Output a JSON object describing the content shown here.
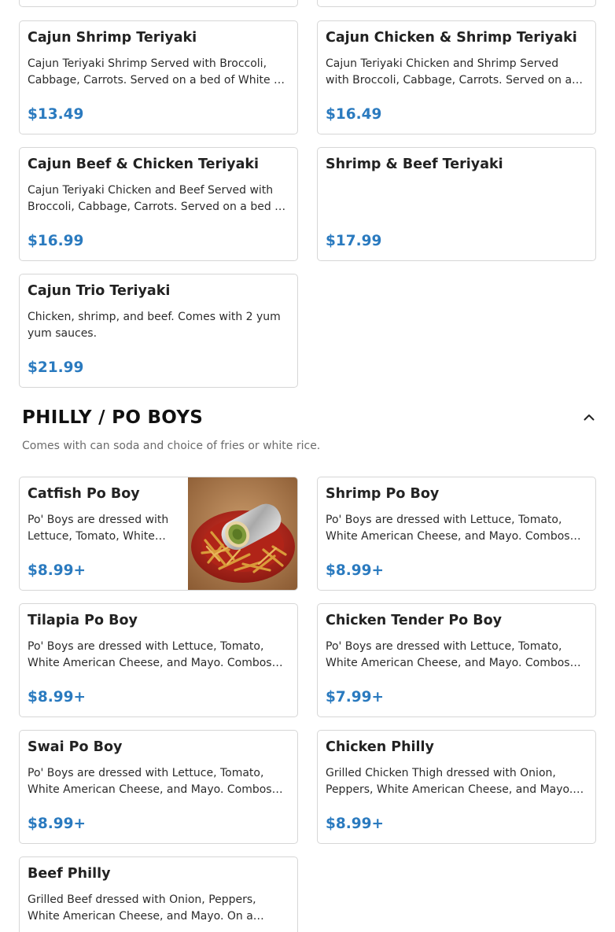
{
  "items_top": [
    {
      "name": "Cajun Shrimp Teriyaki",
      "description": "Cajun Teriyaki Shrimp Served with Broccoli, Cabbage, Carrots. Served on a bed of White …",
      "price": "$13.49"
    },
    {
      "name": "Cajun Chicken & Shrimp Teriyaki",
      "description": "Cajun Teriyaki Chicken and Shrimp Served with Broccoli, Cabbage, Carrots. Served on a bed …",
      "price": "$16.49"
    },
    {
      "name": "Cajun Beef & Chicken Teriyaki",
      "description": "Cajun Teriyaki Chicken and Beef Served with Broccoli, Cabbage, Carrots. Served on a bed …",
      "price": "$16.99"
    },
    {
      "name": "Shrimp & Beef Teriyaki",
      "description": "",
      "price": "$17.99"
    },
    {
      "name": "Cajun Trio Teriyaki",
      "description": "Chicken, shrimp, and beef. Comes with 2 yum yum sauces.",
      "price": "$21.99"
    }
  ],
  "section": {
    "title": "PHILLY / PO BOYS",
    "subtitle": "Comes with can soda and choice of fries or white rice.",
    "collapse_icon": "chevron-up-icon"
  },
  "items_po": [
    {
      "name": "Catfish Po Boy",
      "description": "Po' Boys are dressed with Lettuce, Tomato, White…",
      "price": "$8.99+",
      "image": "wrap-with-fries-photo"
    },
    {
      "name": "Shrimp Po Boy",
      "description": "Po' Boys are dressed with Lettuce, Tomato, White American Cheese, and Mayo. Combos…",
      "price": "$8.99+"
    },
    {
      "name": "Tilapia Po Boy",
      "description": "Po' Boys are dressed with Lettuce, Tomato, White American Cheese, and Mayo. Combos…",
      "price": "$8.99+"
    },
    {
      "name": "Chicken Tender Po Boy",
      "description": "Po' Boys are dressed with Lettuce, Tomato, White American Cheese, and Mayo. Combos…",
      "price": "$7.99+"
    },
    {
      "name": "Swai Po Boy",
      "description": "Po' Boys are dressed with Lettuce, Tomato, White American Cheese, and Mayo. Combos…",
      "price": "$8.99+"
    },
    {
      "name": "Chicken Philly",
      "description": "Grilled Chicken Thigh dressed with Onion, Peppers, White American Cheese, and Mayo.…",
      "price": "$8.99+"
    },
    {
      "name": "Beef Philly",
      "description": "Grilled Beef dressed with Onion, Peppers, White American Cheese, and Mayo. On a…",
      "price": ""
    }
  ],
  "colors": {
    "price": "#2a7abf",
    "border": "#d6d6d6",
    "subtitle": "#6b6b6b"
  }
}
